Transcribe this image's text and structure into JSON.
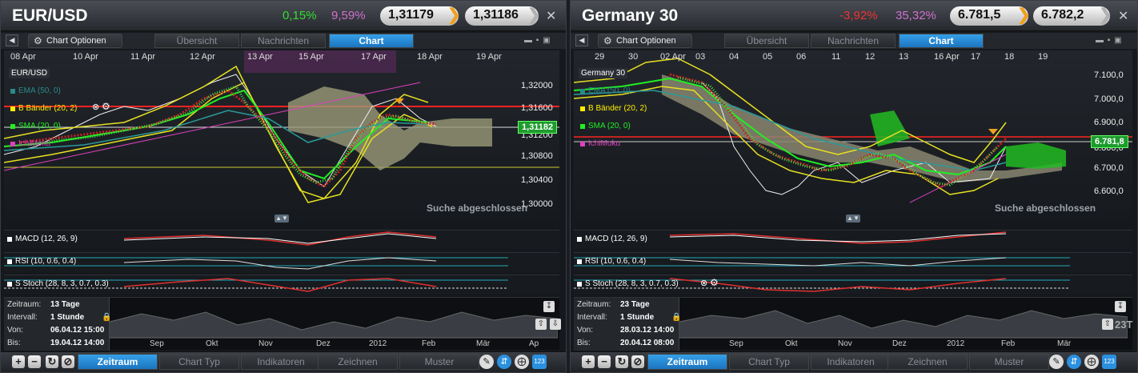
{
  "panels": [
    {
      "title": "EUR/USD",
      "change_pct": "0,15%",
      "change_color": "#33dd33",
      "range_pct": "9,59%",
      "bid": "1,31179",
      "ask": "1,31186",
      "tabs": [
        "Übersicht",
        "Nachrichten",
        "Chart"
      ],
      "chart_options": "Chart Optionen",
      "x_ticks": [
        "08 Apr",
        "10 Apr",
        "11 Apr",
        "12 Apr",
        "13 Apr",
        "15 Apr",
        "17 Apr",
        "18 Apr",
        "19 Apr"
      ],
      "y_ticks": [
        "1,32000",
        "1,31600",
        "1,31200",
        "1,30800",
        "1,30400",
        "1,30000"
      ],
      "current_price": "1,31182",
      "symbol_label": "EUR/USD",
      "indicators": [
        {
          "label": "EMA (50, 0)",
          "color": "#2a8a8a"
        },
        {
          "label": "B Bänder (20, 2)",
          "color": "#ffee00"
        },
        {
          "label": "SMA (20, 0)",
          "color": "#22ee22"
        },
        {
          "label": "IchiMoku",
          "color": "#e040c0"
        }
      ],
      "search_status": "Suche abgeschlossen",
      "subcharts": [
        "MACD (12, 26, 9)",
        "RSI (10, 0.6, 0.4)",
        "S Stoch (28, 8, 3, 0.7, 0.3)"
      ],
      "nav": {
        "zeitraum_label": "Zeitraum:",
        "zeitraum": "13 Tage",
        "intervall_label": "Intervall:",
        "intervall": "1 Stunde",
        "von_label": "Von:",
        "von": "06.04.12 15:00",
        "bis_label": "Bis:",
        "bis": "19.04.12 14:00",
        "months": [
          "Sep",
          "Okt",
          "Nov",
          "Dez",
          "2012",
          "Feb",
          "Mär",
          "Ap"
        ]
      },
      "bottom_tabs": [
        "Zeitraum",
        "Chart Typ",
        "Indikatoren",
        "Zeichnen",
        "Muster"
      ]
    },
    {
      "title": "Germany 30",
      "change_pct": "-3,92%",
      "change_color": "#ee3333",
      "range_pct": "35,32%",
      "bid": "6.781,5",
      "ask": "6.782,2",
      "tabs": [
        "Übersicht",
        "Nachrichten",
        "Chart"
      ],
      "chart_options": "Chart Optionen",
      "x_ticks": [
        "29",
        "30",
        "02 Apr",
        "03",
        "04",
        "05",
        "06",
        "11",
        "12",
        "13",
        "16 Apr",
        "17",
        "18",
        "19"
      ],
      "y_ticks": [
        "7.100,0",
        "7.000,0",
        "6.900,0",
        "6.800,0",
        "6.700,0",
        "6.600,0"
      ],
      "current_price": "6.781,8",
      "symbol_label": "Germany 30",
      "indicators": [
        {
          "label": "EMA (50, 0)",
          "color": "#2a8a8a"
        },
        {
          "label": "B Bänder (20, 2)",
          "color": "#ffee00"
        },
        {
          "label": "SMA (20, 0)",
          "color": "#22ee22"
        },
        {
          "label": "IchiMoku",
          "color": "#e040c0"
        }
      ],
      "search_status": "Suche abgeschlossen",
      "subcharts": [
        "MACD (12, 26, 9)",
        "RSI (10, 0.6, 0.4)",
        "S Stoch (28, 8, 3, 0.7, 0.3)"
      ],
      "nav": {
        "zeitraum_label": "Zeitraum:",
        "zeitraum": "23 Tage",
        "intervall_label": "Intervall:",
        "intervall": "1 Stunde",
        "von_label": "Von:",
        "von": "28.03.12 14:00",
        "bis_label": "Bis:",
        "bis": "20.04.12 08:00",
        "months": [
          "Sep",
          "Okt",
          "Nov",
          "Dez",
          "2012",
          "Feb",
          "Mär"
        ]
      },
      "side_label": "23T",
      "bottom_tabs": [
        "Zeitraum",
        "Chart Typ",
        "Indikatoren",
        "Zeichnen",
        "Muster"
      ]
    }
  ],
  "icons": {
    "close": "close-icon",
    "gear": "gear-icon",
    "pin": "pin-icon",
    "plus": "zoom-in-icon",
    "minus": "zoom-out-icon",
    "refresh": "refresh-icon",
    "reset": "reset-icon",
    "pencil": "pencil-icon",
    "updown": "scroll-icon",
    "crosshair": "crosshair-icon",
    "keypad": "keypad-icon"
  }
}
